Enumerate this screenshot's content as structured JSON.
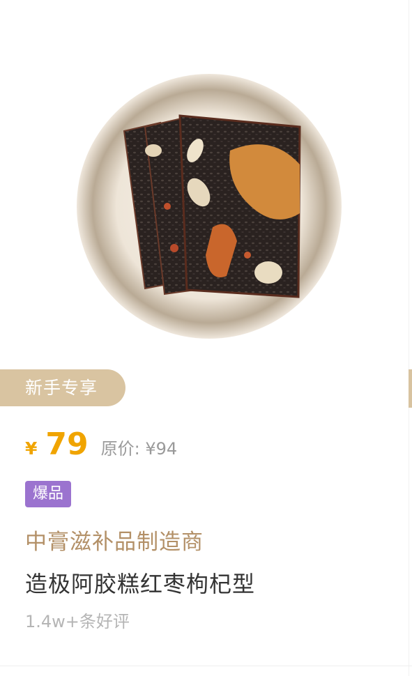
{
  "product": {
    "image_alt_icon": "product-photo-ejiao-cake",
    "promo_tag": "新手专享",
    "currency_symbol": "¥",
    "price": "79",
    "original_price": "原价: ¥94",
    "badge": "爆品",
    "brand": "中膏滋补品制造商",
    "name": "造极阿胶糕红枣枸杞型",
    "reviews": "1.4w+条好评"
  },
  "colors": {
    "accent_gold": "#f0a400",
    "promo_tag_bg": "#d9c4a1",
    "badge_purple": "#9b73cf",
    "brand_text": "#b39067"
  }
}
